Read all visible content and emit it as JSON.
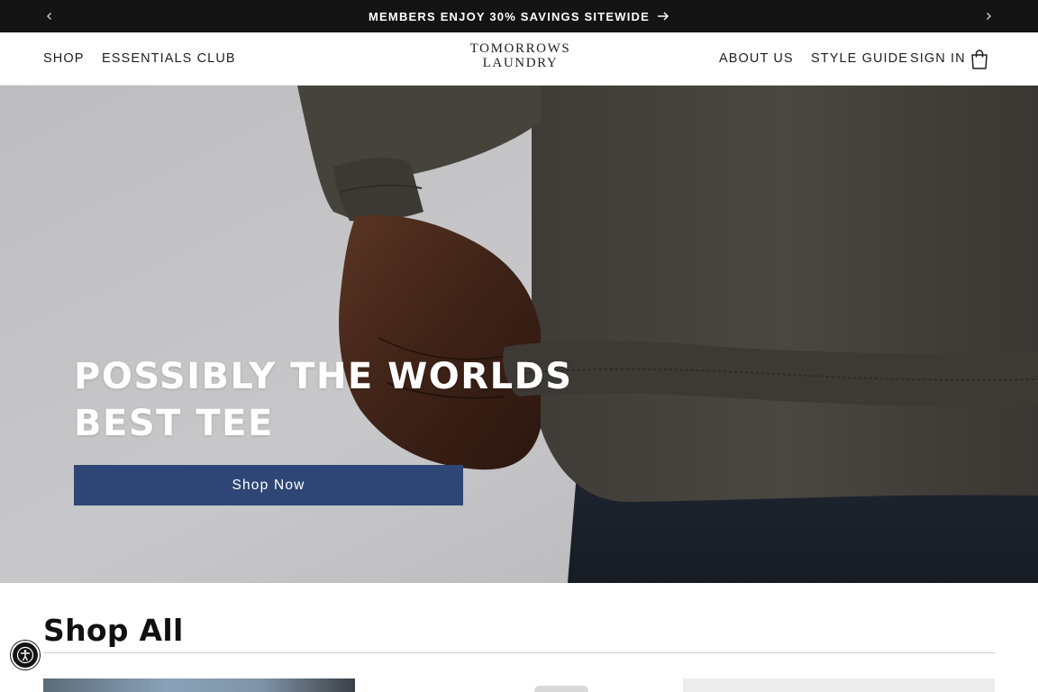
{
  "announcement": {
    "text": "MEMBERS ENJOY 30% SAVINGS SITEWIDE",
    "prev_icon": "chevron-left-icon",
    "next_icon": "chevron-right-icon",
    "link_icon": "arrow-right-icon"
  },
  "header": {
    "left_nav": [
      "SHOP",
      "ESSENTIALS CLUB"
    ],
    "logo_line1": "TOMORROWS",
    "logo_line2": "LAUNDRY",
    "right_nav": [
      "ABOUT US",
      "STYLE GUIDE",
      "SIGN IN"
    ],
    "cart_icon": "shopping-bag-icon"
  },
  "hero": {
    "title_line1": "POSSIBLY THE WORLDS",
    "title_line2": "BEST TEE",
    "cta_label": "Shop Now",
    "cta_color": "#2e4676"
  },
  "shop_all": {
    "title": "Shop All"
  },
  "accessibility": {
    "icon": "accessibility-icon"
  },
  "colors": {
    "announcement_bg": "#141414",
    "accent": "#2e4676"
  }
}
